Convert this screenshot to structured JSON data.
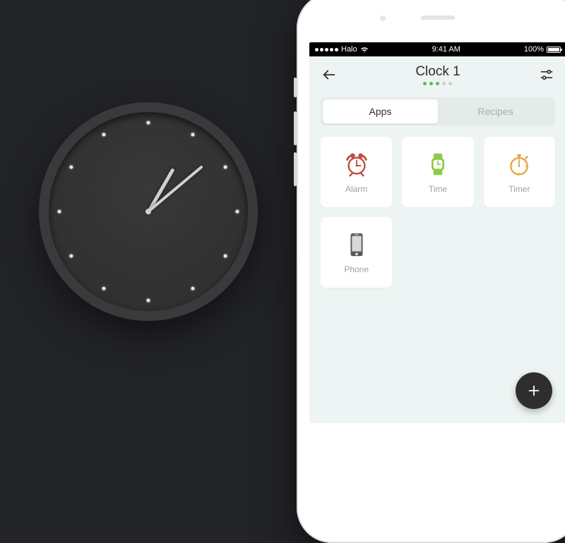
{
  "clock": {
    "hour_angle": 30,
    "minute_angle": 50,
    "dot_count": 12
  },
  "status_bar": {
    "carrier": "Halo",
    "time": "9:41 AM",
    "battery": "100%"
  },
  "header": {
    "title": "Clock 1",
    "page_dots": 5,
    "active_dots": 3
  },
  "tabs": [
    {
      "label": "Apps",
      "active": true
    },
    {
      "label": "Recipes",
      "active": false
    }
  ],
  "apps": [
    {
      "label": "Alarm",
      "icon": "alarm"
    },
    {
      "label": "Time",
      "icon": "watch"
    },
    {
      "label": "Timer",
      "icon": "stopwatch"
    },
    {
      "label": "Phone",
      "icon": "phone"
    }
  ],
  "fab": {
    "label": "Add"
  }
}
